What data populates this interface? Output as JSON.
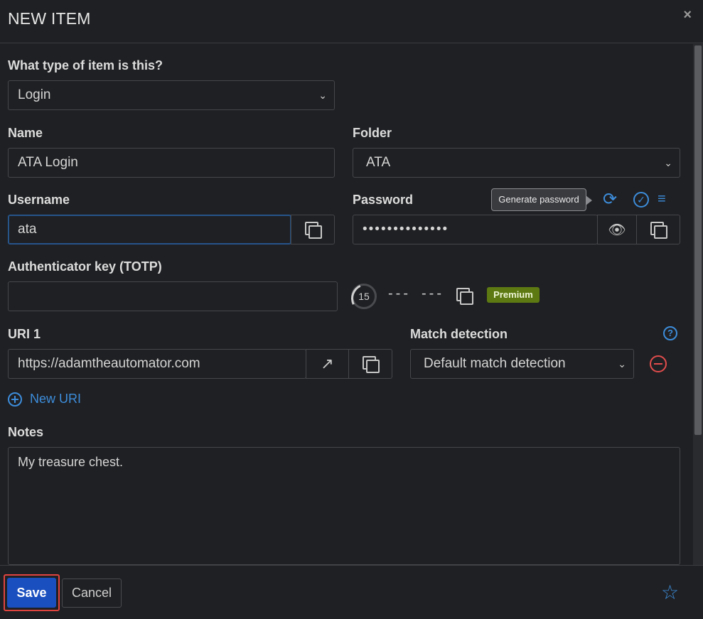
{
  "dialog": {
    "title": "NEW ITEM",
    "close_icon": "close-icon"
  },
  "type": {
    "label": "What type of item is this?",
    "value": "Login"
  },
  "name": {
    "label": "Name",
    "value": "ATA Login"
  },
  "folder": {
    "label": "Folder",
    "value": "ATA"
  },
  "username": {
    "label": "Username",
    "value": "ata"
  },
  "password": {
    "label": "Password",
    "value": "••••••••••••••",
    "tooltip": "Generate password"
  },
  "totp": {
    "label": "Authenticator key (TOTP)",
    "value": "",
    "timer": "15",
    "code_part1": "---",
    "code_part2": "---",
    "badge": "Premium"
  },
  "uri": {
    "label": "URI 1",
    "value": "https://adamtheautomator.com"
  },
  "match": {
    "label": "Match detection",
    "value": "Default match detection"
  },
  "new_uri": {
    "label": "New URI"
  },
  "notes": {
    "label": "Notes",
    "value": "My treasure chest."
  },
  "footer": {
    "save_label": "Save",
    "cancel_label": "Cancel"
  },
  "colors": {
    "accent": "#3d8ddb",
    "save": "#1a4fbf",
    "danger": "#e24d4d",
    "premium": "#5d7a12"
  }
}
